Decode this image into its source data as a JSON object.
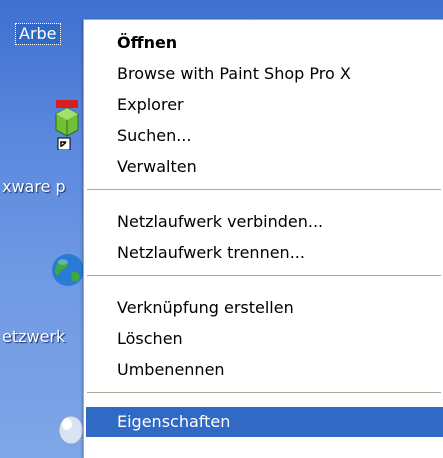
{
  "desktop": {
    "labels": [
      "Arbe",
      "xware p",
      "etzwerk"
    ]
  },
  "context_menu": {
    "items": [
      {
        "label": "Öffnen"
      },
      {
        "label": "Browse with Paint Shop Pro X"
      },
      {
        "label": "Explorer"
      },
      {
        "label": "Suchen..."
      },
      {
        "label": "Verwalten"
      },
      {
        "label": "Netzlaufwerk verbinden..."
      },
      {
        "label": "Netzlaufwerk trennen..."
      },
      {
        "label": "Verknüpfung erstellen"
      },
      {
        "label": "Löschen"
      },
      {
        "label": "Umbenennen"
      },
      {
        "label": "Eigenschaften"
      }
    ],
    "default_item": "Öffnen",
    "highlighted_item": "Eigenschaften"
  },
  "colors": {
    "highlight": "#316ac5",
    "desktop_blue": "#5a88de",
    "separator": "#aca899"
  }
}
